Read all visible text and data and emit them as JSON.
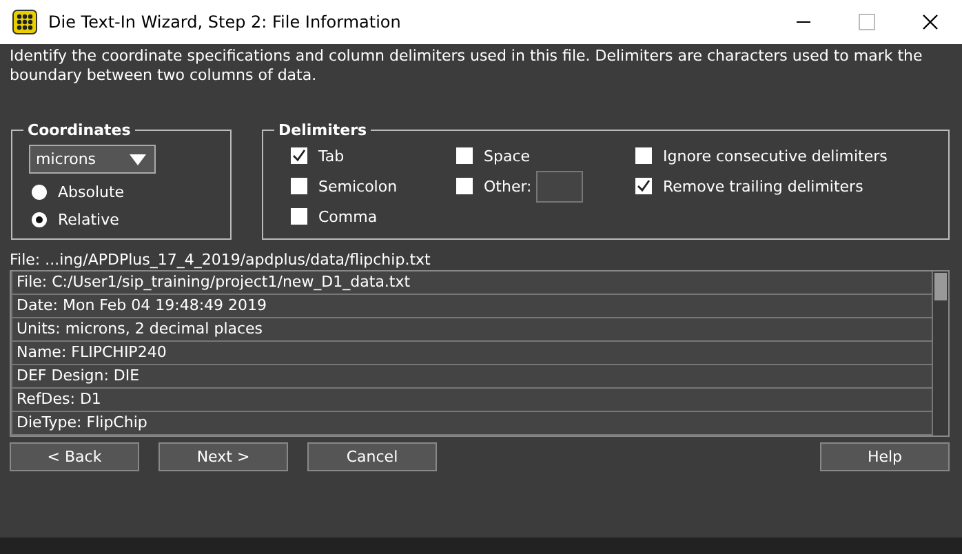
{
  "window": {
    "title": "Die Text-In Wizard, Step 2: File Information"
  },
  "instructions": "Identify the coordinate specifications and column delimiters used in this file. Delimiters are characters used to mark the boundary between two columns of data.",
  "coordinates": {
    "title": "Coordinates",
    "units": "microns",
    "options": [
      {
        "label": "Absolute",
        "selected": false
      },
      {
        "label": "Relative",
        "selected": true
      }
    ]
  },
  "delimiters": {
    "title": "Delimiters",
    "options": [
      {
        "label": "Tab",
        "checked": true,
        "kind": "check"
      },
      {
        "label": "Space",
        "checked": false,
        "kind": "check"
      },
      {
        "label": "Ignore consecutive delimiters",
        "checked": false,
        "kind": "check"
      },
      {
        "label": "Semicolon",
        "checked": false,
        "kind": "check"
      },
      {
        "label": "Other:",
        "checked": false,
        "kind": "other"
      },
      {
        "label": "Remove trailing delimiters",
        "checked": true,
        "kind": "check"
      },
      {
        "label": "Comma",
        "checked": false,
        "kind": "check"
      }
    ]
  },
  "file_label": "File: ...ing/APDPlus_17_4_2019/apdplus/data/flipchip.txt",
  "preview_lines": [
    "File: C:/User1/sip_training/project1/new_D1_data.txt",
    "Date: Mon Feb 04 19:48:49 2019",
    "Units: microns, 2 decimal places",
    "Name: FLIPCHIP240",
    "DEF Design: DIE",
    "RefDes: D1",
    "DieType: FlipChip"
  ],
  "buttons": {
    "left": [
      "< Back",
      "Next >",
      "Cancel"
    ],
    "right": [
      "Help"
    ]
  }
}
